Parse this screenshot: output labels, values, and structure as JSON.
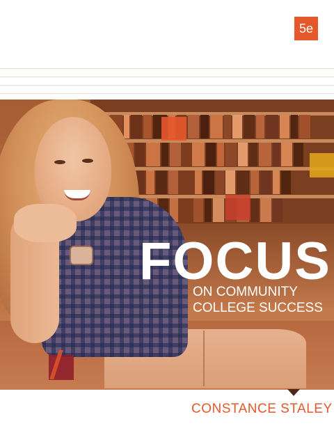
{
  "cover": {
    "edition": "5e",
    "title": "FOCUS",
    "subtitle_line1": "ON COMMUNITY",
    "subtitle_line2": "COLLEGE SUCCESS",
    "author": "CONSTANCE STALEY"
  },
  "colors": {
    "accent_orange": "#e4582b",
    "accent_yellow": "#e0a21c",
    "accent_red": "#c8402d",
    "accent_crimson": "#8f1f2a",
    "photo_tint": "#b4693a"
  },
  "image": {
    "scene": "cover-photo"
  }
}
